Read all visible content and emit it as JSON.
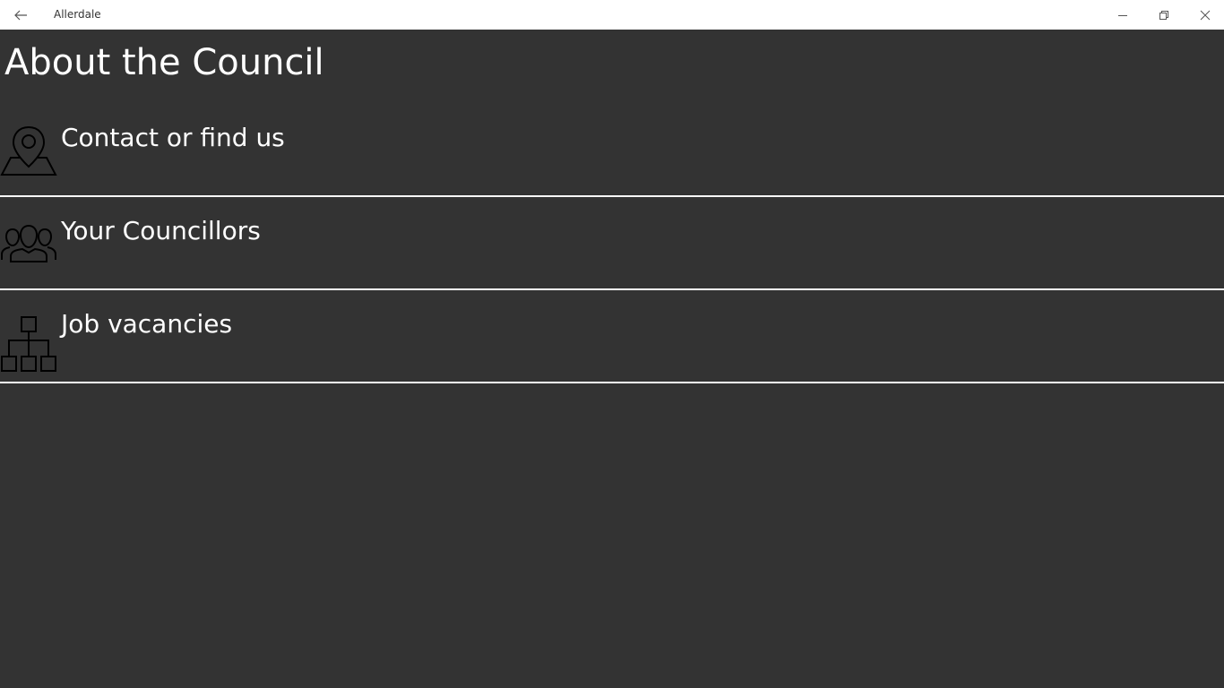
{
  "window": {
    "app_title": "Allerdale",
    "icons": {
      "back": "back-arrow-icon",
      "minimize": "minimize-icon",
      "restore": "restore-icon",
      "close": "close-icon"
    }
  },
  "page": {
    "title": "About the Council"
  },
  "menu": {
    "items": [
      {
        "label": "Contact or find us",
        "icon": "map-pin-icon"
      },
      {
        "label": "Your Councillors",
        "icon": "people-group-icon"
      },
      {
        "label": "Job vacancies",
        "icon": "org-chart-icon"
      }
    ]
  },
  "colors": {
    "background": "#333333",
    "titlebar": "#ffffff",
    "foreground": "#ffffff",
    "divider": "#ffffff"
  }
}
